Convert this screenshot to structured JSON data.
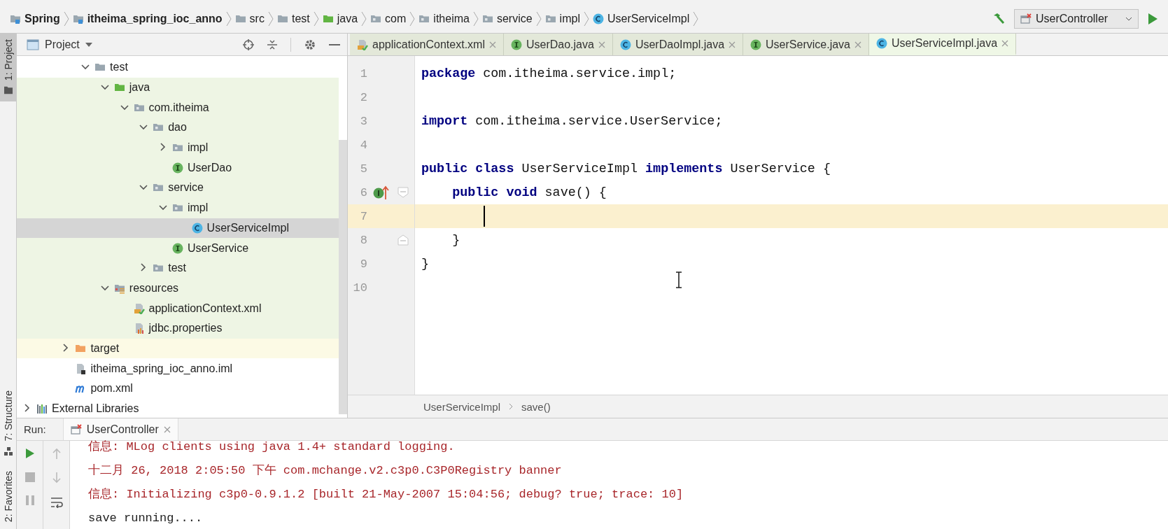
{
  "navbar": {
    "crumbs": [
      {
        "label": "Spring",
        "kind": "module",
        "bold": true
      },
      {
        "label": "itheima_spring_ioc_anno",
        "kind": "module",
        "bold": true
      },
      {
        "label": "src",
        "kind": "folder",
        "bold": false
      },
      {
        "label": "test",
        "kind": "folder",
        "bold": false
      },
      {
        "label": "java",
        "kind": "test-root",
        "bold": false
      },
      {
        "label": "com",
        "kind": "package",
        "bold": false
      },
      {
        "label": "itheima",
        "kind": "package",
        "bold": false
      },
      {
        "label": "service",
        "kind": "package",
        "bold": false
      },
      {
        "label": "impl",
        "kind": "package",
        "bold": false
      },
      {
        "label": "UserServiceImpl",
        "kind": "class",
        "bold": false
      }
    ],
    "run_config": "UserController"
  },
  "side_tools": {
    "top": [
      {
        "label": "1: Project",
        "selected": true
      }
    ],
    "bottom": [
      {
        "label": "7: Structure",
        "selected": false
      },
      {
        "label": "2: Favorites",
        "selected": false
      }
    ]
  },
  "project": {
    "title": "Project",
    "tree": [
      {
        "children": [
          {
            "children": [
              {
                "children": [
                  {
                    "label": "test",
                    "kind": "folder",
                    "expanded": true,
                    "selected": false,
                    "children": [
                      {
                        "label": "java",
                        "kind": "test-root",
                        "expanded": true,
                        "selected": false,
                        "color": "#eef5e4",
                        "children": [
                          {
                            "label": "com.itheima",
                            "kind": "package",
                            "expanded": true,
                            "selected": false,
                            "color": "#eef5e4",
                            "children": [
                              {
                                "label": "dao",
                                "kind": "package",
                                "expanded": true,
                                "selected": false,
                                "color": "#eef5e4",
                                "children": [
                                  {
                                    "label": "impl",
                                    "kind": "package",
                                    "expanded": false,
                                    "selected": false,
                                    "color": "#eef5e4"
                                  },
                                  {
                                    "label": "UserDao",
                                    "kind": "interface",
                                    "selected": false,
                                    "color": "#eef5e4"
                                  }
                                ]
                              },
                              {
                                "label": "service",
                                "kind": "package",
                                "expanded": true,
                                "selected": false,
                                "color": "#eef5e4",
                                "children": [
                                  {
                                    "label": "impl",
                                    "kind": "package",
                                    "expanded": true,
                                    "selected": false,
                                    "color": "#eef5e4",
                                    "children": [
                                      {
                                        "label": "UserServiceImpl",
                                        "kind": "class",
                                        "selected": true
                                      }
                                    ]
                                  },
                                  {
                                    "label": "UserService",
                                    "kind": "interface",
                                    "selected": false,
                                    "color": "#eef5e4"
                                  }
                                ]
                              },
                              {
                                "label": "test",
                                "kind": "package",
                                "expanded": false,
                                "selected": false,
                                "color": "#eef5e4"
                              }
                            ]
                          }
                        ]
                      },
                      {
                        "label": "resources",
                        "kind": "resource-root",
                        "expanded": true,
                        "selected": false,
                        "color": "#eef5e4",
                        "children": [
                          {
                            "label": "applicationContext.xml",
                            "kind": "xml",
                            "selected": false,
                            "color": "#eef5e4"
                          },
                          {
                            "label": "jdbc.properties",
                            "kind": "properties",
                            "selected": false,
                            "color": "#eef5e4"
                          }
                        ]
                      }
                    ]
                  }
                ]
              },
              {
                "label": "target",
                "kind": "excluded",
                "expanded": false,
                "selected": false,
                "color": "#fcfae5"
              },
              {
                "label": "itheima_spring_ioc_anno.iml",
                "kind": "iml",
                "selected": false
              },
              {
                "label": "pom.xml",
                "kind": "maven",
                "selected": false
              }
            ]
          }
        ]
      },
      {
        "label": "External Libraries",
        "kind": "libraries",
        "expanded": false,
        "selected": false
      }
    ]
  },
  "editor": {
    "tabs": [
      {
        "label": "applicationContext.xml",
        "kind": "xml",
        "selected": false
      },
      {
        "label": "UserDao.java",
        "kind": "interface",
        "selected": false
      },
      {
        "label": "UserDaoImpl.java",
        "kind": "class",
        "selected": false
      },
      {
        "label": "UserService.java",
        "kind": "interface",
        "selected": false
      },
      {
        "label": "UserServiceImpl.java",
        "kind": "class",
        "selected": true
      }
    ],
    "lines": [
      {
        "number": "1",
        "current": false,
        "segments": [
          {
            "text": "package",
            "kind": "keyword"
          },
          {
            "text": " com.itheima.service.impl;",
            "kind": "plain"
          }
        ]
      },
      {
        "number": "2",
        "current": false
      },
      {
        "number": "3",
        "current": false,
        "segments": [
          {
            "text": "import",
            "kind": "keyword"
          },
          {
            "text": " com.itheima.service.UserService;",
            "kind": "plain"
          }
        ]
      },
      {
        "number": "4",
        "current": false
      },
      {
        "number": "5",
        "current": false,
        "segments": [
          {
            "text": "public class",
            "kind": "keyword"
          },
          {
            "text": " UserServiceImpl ",
            "kind": "plain"
          },
          {
            "text": "implements",
            "kind": "keyword"
          },
          {
            "text": " UserService {",
            "kind": "plain"
          }
        ]
      },
      {
        "number": "6",
        "current": false,
        "kind": "member",
        "gutter": [
          {
            "kind": "implements"
          },
          {
            "kind": "fold-start"
          }
        ],
        "segments": [
          {
            "text": "public void",
            "kind": "keyword"
          },
          {
            "text": " save() {",
            "kind": "plain"
          }
        ]
      },
      {
        "number": "7",
        "current": true,
        "caret": true
      },
      {
        "number": "8",
        "current": false,
        "kind": "member",
        "gutter": [
          {
            "kind": "fold-end"
          }
        ],
        "segments": [
          {
            "text": "}",
            "kind": "plain"
          }
        ]
      },
      {
        "number": "9",
        "current": false,
        "segments": [
          {
            "text": "}",
            "kind": "plain"
          }
        ]
      },
      {
        "number": "10",
        "current": false
      }
    ],
    "breadcrumbs": [
      "UserServiceImpl",
      "save()"
    ]
  },
  "run": {
    "label": "Run:",
    "tabs": [
      {
        "label": "UserController",
        "selected": true
      }
    ],
    "lines": [
      {
        "text": "信息: MLog clients using java 1.4+ standard logging.",
        "kind": "stderr"
      },
      {
        "text": "十二月 26, 2018 2:05:50 下午 com.mchange.v2.c3p0.C3P0Registry banner",
        "kind": "stderr"
      },
      {
        "text": "信息: Initializing c3p0-0.9.1.2 [built 21-May-2007 15:04:56; debug? true; trace: 10]",
        "kind": "stderr"
      },
      {
        "text": "save running....",
        "kind": "stdout"
      }
    ]
  }
}
